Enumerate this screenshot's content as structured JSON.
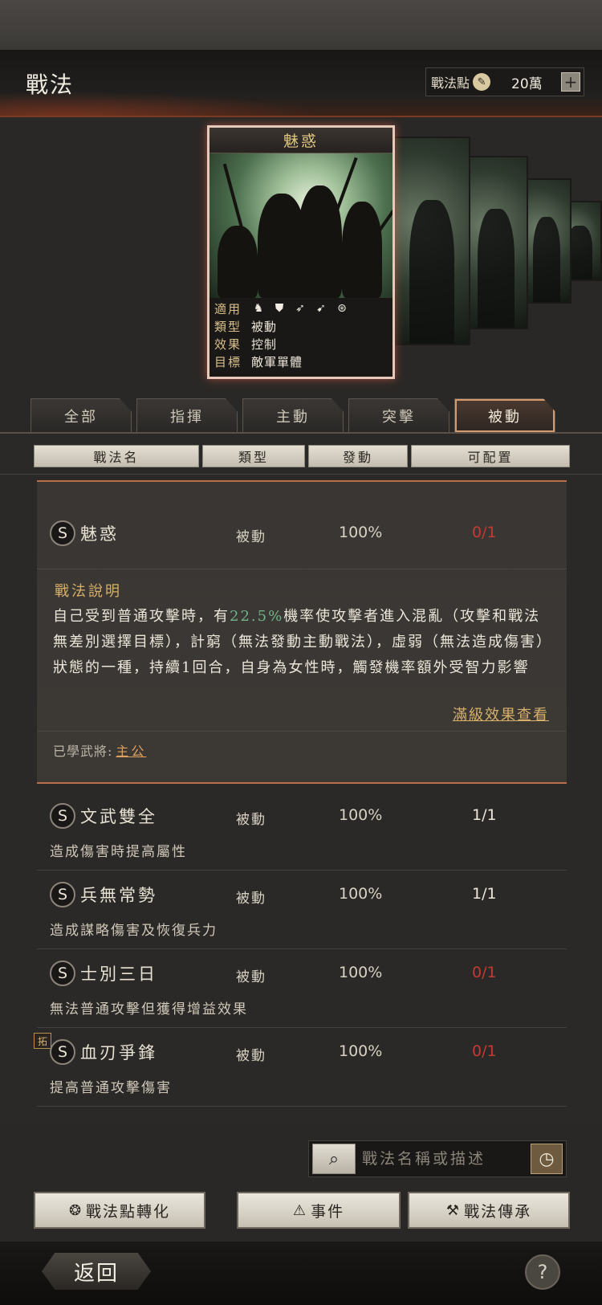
{
  "header": {
    "title": "戰法",
    "points_label": "戰法點",
    "points_value": "20萬",
    "add_label": "+"
  },
  "card": {
    "title": "魅惑",
    "info": [
      {
        "key": "適用",
        "value": ""
      },
      {
        "key": "類型",
        "value": "被動"
      },
      {
        "key": "效果",
        "value": "控制"
      },
      {
        "key": "目標",
        "value": "敵軍單體"
      }
    ],
    "applicable_icons": [
      "cavalry-icon",
      "shield-icon",
      "bow-icon",
      "spear-icon",
      "wheel-icon"
    ]
  },
  "tabs": [
    {
      "label": "全部",
      "active": false
    },
    {
      "label": "指揮",
      "active": false
    },
    {
      "label": "主動",
      "active": false
    },
    {
      "label": "突擊",
      "active": false
    },
    {
      "label": "被動",
      "active": true
    }
  ],
  "columns": [
    "戰法名",
    "類型",
    "發動",
    "可配置"
  ],
  "expanded_item": {
    "grade": "S",
    "name": "魅惑",
    "type": "被動",
    "rate": "100%",
    "config": "0/1",
    "desc_title": "戰法說明",
    "desc_part1": "自己受到普通攻擊時，有",
    "desc_highlight": "22.5%",
    "desc_part2": "機率使攻擊者進入混亂（攻擊和戰法無差別選擇目標），計窮（無法發動主動戰法），虛弱（無法造成傷害）狀態的一種，持續1回合，自身為女性時，觸發機率額外受智力影響",
    "full_effect_link": "滿級效果查看",
    "learned_label": "已學武將:",
    "learned_name": "主公"
  },
  "items": [
    {
      "grade": "S",
      "name": "文武雙全",
      "type": "被動",
      "rate": "100%",
      "config": "1/1",
      "config_full": false,
      "desc": "造成傷害時提高屬性",
      "tag": ""
    },
    {
      "grade": "S",
      "name": "兵無常勢",
      "type": "被動",
      "rate": "100%",
      "config": "1/1",
      "config_full": false,
      "desc": "造成謀略傷害及恢復兵力",
      "tag": ""
    },
    {
      "grade": "S",
      "name": "士別三日",
      "type": "被動",
      "rate": "100%",
      "config": "0/1",
      "config_full": true,
      "desc": "無法普通攻擊但獲得增益效果",
      "tag": ""
    },
    {
      "grade": "S",
      "name": "血刃爭鋒",
      "type": "被動",
      "rate": "100%",
      "config": "0/1",
      "config_full": true,
      "desc": "提高普通攻擊傷害",
      "tag": "拓"
    }
  ],
  "search": {
    "placeholder": "戰法名稱或描述"
  },
  "actions": {
    "convert": "戰法點轉化",
    "events": "事件",
    "inherit": "戰法傳承"
  },
  "footer": {
    "back": "返回",
    "help": "?"
  },
  "colors": {
    "accent_gold": "#d6b06a",
    "red_count": "#c43a32",
    "highlight_green": "#6fb48a"
  }
}
